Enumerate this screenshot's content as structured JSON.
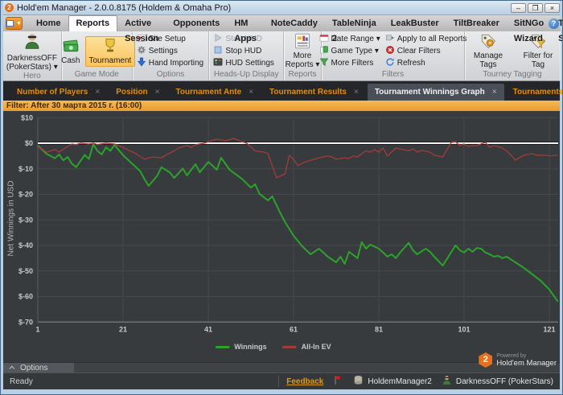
{
  "window": {
    "title": "Hold'em Manager - 2.0.0.8175 (Holdem & Omaha Pro)",
    "logo_glyph": "2",
    "controls": {
      "minimize": "–",
      "maximize": "❐",
      "close": "×"
    }
  },
  "ribbon_tabs": {
    "items": [
      "Home",
      "Reports",
      "Active Session",
      "Opponents",
      "HM Apps",
      "NoteCaddy",
      "TableNinja 2",
      "LeakBuster",
      "TiltBreaker",
      "SitNGo Wizard",
      "Table Scanner"
    ],
    "active_index": 1,
    "help_glyph": "?"
  },
  "ribbon": {
    "hero": {
      "player": "DarknessOFF (PokerStars) ▾",
      "caption": "Hero"
    },
    "game_mode": {
      "cash": "Cash",
      "tournament": "Tournament",
      "caption": "Game Mode"
    },
    "options": {
      "site_setup": "Site Setup",
      "settings": "Settings",
      "hand_importing": "Hand Importing",
      "caption": "Options"
    },
    "hud": {
      "start": "Start HUD",
      "stop": "Stop HUD",
      "settings": "HUD Settings",
      "caption": "Heads-Up Display"
    },
    "reports": {
      "more": "More Reports ▾",
      "caption": "Reports"
    },
    "filters": {
      "date_range": "Date Range ▾",
      "game_type": "Game Type ▾",
      "more_filters": "More Filters",
      "apply_all": "Apply to all Reports",
      "clear": "Clear Filters",
      "refresh": "Refresh",
      "caption": "Filters"
    },
    "tagging": {
      "manage": "Manage Tags",
      "filter": "Filter for Tag",
      "caption": "Tourney Tagging"
    }
  },
  "report_tabs": {
    "close_glyph": "×",
    "active_index": 4,
    "items": [
      "Number of Players",
      "Position",
      "Tournament Ante",
      "Tournament Results",
      "Tournament Winnings Graph",
      "Tournaments"
    ]
  },
  "filter_bar": {
    "text": "Filter: After 30 марта 2015 г. (16:00)"
  },
  "chart_data": {
    "type": "line",
    "ylabel": "Net Winnings in USD",
    "xlabel": "",
    "xlim": [
      1,
      124
    ],
    "ylim": [
      -70,
      10
    ],
    "grid": true,
    "zero_line": true,
    "legend_position": "bottom-center",
    "ytick_values": [
      10,
      0,
      -10,
      -20,
      -30,
      -40,
      -50,
      -60,
      -70
    ],
    "ytick_labels": [
      "$10",
      "$0",
      "$-10",
      "$-20",
      "$-30",
      "$-40",
      "$-50",
      "$-60",
      "$-70"
    ],
    "xticks": [
      1,
      21,
      41,
      61,
      81,
      101,
      121
    ],
    "series": [
      {
        "name": "Winnings",
        "color": "#2ba32b",
        "width": 2,
        "points": [
          [
            1,
            -0.9
          ],
          [
            3,
            -4.1
          ],
          [
            5,
            -5.9
          ],
          [
            6,
            -4.4
          ],
          [
            7,
            -6.7
          ],
          [
            8,
            -5.4
          ],
          [
            9,
            -8.0
          ],
          [
            10,
            -9.4
          ],
          [
            12,
            -4.6
          ],
          [
            13,
            -6.2
          ],
          [
            14,
            -0.4
          ],
          [
            15,
            -3.0
          ],
          [
            16,
            -4.4
          ],
          [
            17,
            -1.6
          ],
          [
            18,
            -3.0
          ],
          [
            19,
            -0.7
          ],
          [
            21,
            -4.7
          ],
          [
            23,
            -7.8
          ],
          [
            25,
            -10.9
          ],
          [
            26,
            -14.0
          ],
          [
            27,
            -16.7
          ],
          [
            29,
            -12.8
          ],
          [
            30,
            -9.4
          ],
          [
            32,
            -11.5
          ],
          [
            33,
            -13.6
          ],
          [
            35,
            -9.9
          ],
          [
            36,
            -12.6
          ],
          [
            38,
            -8.2
          ],
          [
            39,
            -11.4
          ],
          [
            41,
            -7.3
          ],
          [
            43,
            -10.4
          ],
          [
            44,
            -5.7
          ],
          [
            46,
            -10.4
          ],
          [
            49,
            -14.1
          ],
          [
            51,
            -17.4
          ],
          [
            52,
            -16.1
          ],
          [
            53,
            -19.8
          ],
          [
            55,
            -22.4
          ],
          [
            56,
            -20.8
          ],
          [
            58,
            -27.7
          ],
          [
            59,
            -30.9
          ],
          [
            61,
            -36.2
          ],
          [
            63,
            -40.3
          ],
          [
            65,
            -43.5
          ],
          [
            67,
            -41.3
          ],
          [
            69,
            -44.4
          ],
          [
            71,
            -46.6
          ],
          [
            72,
            -44.4
          ],
          [
            73,
            -47.2
          ],
          [
            74,
            -42.5
          ],
          [
            76,
            -45.0
          ],
          [
            77,
            -38.7
          ],
          [
            78,
            -41.3
          ],
          [
            79,
            -39.7
          ],
          [
            81,
            -41.3
          ],
          [
            82,
            -42.8
          ],
          [
            83,
            -44.4
          ],
          [
            84,
            -43.5
          ],
          [
            85,
            -45.0
          ],
          [
            86,
            -42.8
          ],
          [
            88,
            -39.0
          ],
          [
            89,
            -41.9
          ],
          [
            90,
            -43.5
          ],
          [
            92,
            -41.3
          ],
          [
            93,
            -42.5
          ],
          [
            94,
            -44.4
          ],
          [
            96,
            -47.9
          ],
          [
            99,
            -40.0
          ],
          [
            100,
            -41.9
          ],
          [
            101,
            -42.8
          ],
          [
            102,
            -41.3
          ],
          [
            103,
            -42.5
          ],
          [
            104,
            -41.0
          ],
          [
            105,
            -41.3
          ],
          [
            106,
            -42.8
          ],
          [
            107,
            -43.5
          ],
          [
            108,
            -44.4
          ],
          [
            109,
            -44.1
          ],
          [
            110,
            -45.0
          ],
          [
            111,
            -44.4
          ],
          [
            113,
            -46.6
          ],
          [
            115,
            -48.8
          ],
          [
            117,
            -51.3
          ],
          [
            119,
            -53.9
          ],
          [
            121,
            -57.3
          ],
          [
            123,
            -62.0
          ]
        ]
      },
      {
        "name": "All-In EV",
        "color": "#a33b3b",
        "width": 1.3,
        "points": [
          [
            1,
            -1.3
          ],
          [
            3,
            -3.5
          ],
          [
            5,
            -2.5
          ],
          [
            6,
            -3.5
          ],
          [
            8,
            -1.3
          ],
          [
            9,
            -0.3
          ],
          [
            10,
            -0.6
          ],
          [
            11,
            0.0
          ],
          [
            13,
            -0.3
          ],
          [
            14,
            0.0
          ],
          [
            15,
            -0.5
          ],
          [
            17,
            0.0
          ],
          [
            19,
            -0.3
          ],
          [
            20,
            -0.9
          ],
          [
            22,
            -2.5
          ],
          [
            24,
            -4.1
          ],
          [
            26,
            -6.3
          ],
          [
            28,
            -5.4
          ],
          [
            30,
            -5.7
          ],
          [
            31,
            -4.7
          ],
          [
            33,
            -3.0
          ],
          [
            34,
            -1.9
          ],
          [
            36,
            -0.9
          ],
          [
            37,
            -1.6
          ],
          [
            38,
            -0.6
          ],
          [
            40,
            0.0
          ],
          [
            41,
            0.6
          ],
          [
            43,
            1.6
          ],
          [
            45,
            0.9
          ],
          [
            47,
            1.9
          ],
          [
            48,
            1.2
          ],
          [
            50,
            0.0
          ],
          [
            52,
            -3.0
          ],
          [
            54,
            -3.5
          ],
          [
            55,
            -4.1
          ],
          [
            57,
            -13.5
          ],
          [
            59,
            -12.0
          ],
          [
            60,
            -4.7
          ],
          [
            61,
            -6.3
          ],
          [
            62,
            -8.8
          ],
          [
            63,
            -7.9
          ],
          [
            64,
            -7.2
          ],
          [
            67,
            -5.7
          ],
          [
            69,
            -5.0
          ],
          [
            70,
            -5.4
          ],
          [
            71,
            -6.3
          ],
          [
            73,
            -5.7
          ],
          [
            74,
            -6.0
          ],
          [
            75,
            -5.0
          ],
          [
            76,
            -5.4
          ],
          [
            77,
            -4.1
          ],
          [
            78,
            -3.0
          ],
          [
            79,
            -3.5
          ],
          [
            80,
            -2.5
          ],
          [
            81,
            -3.5
          ],
          [
            82,
            -1.9
          ],
          [
            83,
            -5.0
          ],
          [
            85,
            -1.9
          ],
          [
            88,
            -3.0
          ],
          [
            89,
            -2.2
          ],
          [
            90,
            -3.5
          ],
          [
            91,
            -2.8
          ],
          [
            93,
            -3.5
          ],
          [
            94,
            -4.7
          ],
          [
            96,
            -5.4
          ],
          [
            98,
            0.3
          ],
          [
            99,
            0.6
          ],
          [
            100,
            -0.9
          ],
          [
            101,
            -0.3
          ],
          [
            102,
            -1.3
          ],
          [
            103,
            -0.9
          ],
          [
            104,
            -0.9
          ],
          [
            106,
            0.3
          ],
          [
            107,
            -1.6
          ],
          [
            108,
            -0.9
          ],
          [
            110,
            -1.9
          ],
          [
            111,
            -3.0
          ],
          [
            112,
            -4.7
          ],
          [
            113,
            -6.6
          ],
          [
            114,
            -5.7
          ],
          [
            115,
            -4.7
          ],
          [
            117,
            -4.1
          ],
          [
            118,
            -4.7
          ],
          [
            120,
            -4.7
          ],
          [
            121,
            -5.0
          ],
          [
            123,
            -4.7
          ]
        ]
      }
    ]
  },
  "options_bar": {
    "label": "Options"
  },
  "powered_by": {
    "badge": "2",
    "line1": "Powered by",
    "line2": "Hold'em Manager"
  },
  "status_bar": {
    "ready": "Ready",
    "feedback": "Feedback",
    "account": "HoldemManager2",
    "hero": "DarknessOFF (PokerStars)"
  },
  "colors": {
    "accent_orange": "#ef9b2d",
    "tab_text_orange": "#e08f0e",
    "winnings_green": "#2ba32b",
    "allin_red": "#a33b3b",
    "panel_dark": "#383b3d",
    "zero_line": "#f4f4f4"
  }
}
